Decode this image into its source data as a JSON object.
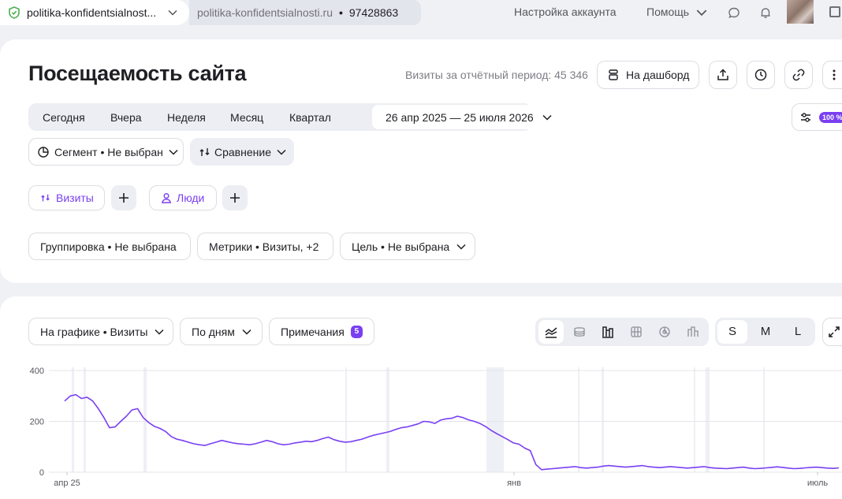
{
  "topbar": {
    "site_name": "politika-konfidentsialnost...",
    "counter_domain": "politika-konfidentsialnosti.ru",
    "counter_separator": "•",
    "counter_id": "97428863",
    "account_settings": "Настройка аккаунта",
    "help": "Помощь"
  },
  "header": {
    "title": "Посещаемость сайта",
    "visits_total": "Визиты за отчётный период: 45 346",
    "dashboard_button": "На дашборд"
  },
  "period": {
    "options": [
      "Сегодня",
      "Вчера",
      "Неделя",
      "Месяц",
      "Квартал"
    ],
    "selected_range": "26 апр 2025 — 25 июля 2026",
    "sampling_badge": "100 %"
  },
  "filters": {
    "segment": "Сегмент • Не выбран",
    "comparison": "Сравнение"
  },
  "reports": {
    "visits": "Визиты",
    "people": "Люди"
  },
  "settings": {
    "grouping": "Группировка • Не выбрана",
    "metrics": "Метрики • Визиты, +2",
    "goal": "Цель • Не выбрана"
  },
  "chart_controls": {
    "on_chart": "На графике • Визиты",
    "by_days": "По дням",
    "notes": "Примечания",
    "notes_count": "5",
    "chart_types": [
      "line-chart-icon",
      "area-stack-icon",
      "bar-chart-icon",
      "table-grid-icon",
      "pie-chart-icon",
      "column-chart-icon"
    ],
    "sizes": [
      "S",
      "M",
      "L"
    ],
    "selected_size": "S"
  },
  "colors": {
    "accent": "#7a3ff2",
    "series": "#7a3ff2",
    "gridline": "#e4e5ea"
  },
  "chart_data": {
    "type": "line",
    "title": "",
    "xlabel": "",
    "ylabel": "",
    "ylim": [
      0,
      400
    ],
    "y_ticks": [
      0,
      200,
      400
    ],
    "x_ticks": [
      "апр 25",
      "янв",
      "июль"
    ],
    "grid": "horizontal",
    "series": [
      {
        "values": [
          280,
          300,
          305,
          290,
          295,
          280,
          250,
          215,
          175,
          178,
          200,
          220,
          245,
          250,
          215,
          195,
          180,
          172,
          160,
          140,
          130,
          125,
          118,
          112,
          108,
          105,
          112,
          118,
          125,
          120,
          115,
          112,
          110,
          108,
          112,
          118,
          125,
          120,
          112,
          108,
          110,
          115,
          118,
          122,
          120,
          125,
          132,
          138,
          128,
          122,
          118,
          120,
          125,
          130,
          138,
          145,
          150,
          155,
          160,
          168,
          175,
          178,
          184,
          190,
          200,
          198,
          192,
          205,
          210,
          212,
          220,
          215,
          206,
          200,
          192,
          180,
          165,
          152,
          140,
          128,
          115,
          110,
          95,
          85,
          30,
          10,
          12,
          14,
          16,
          18,
          20,
          22,
          18,
          16,
          18,
          20,
          24,
          26,
          24,
          22,
          20,
          22,
          24,
          26,
          22,
          20,
          18,
          20,
          22,
          20,
          18,
          16,
          18,
          20,
          22,
          18,
          16,
          15,
          14,
          16,
          18,
          20,
          16,
          14,
          15,
          17,
          19,
          21,
          19,
          16,
          14,
          15,
          17,
          19,
          20,
          18,
          16,
          15,
          17
        ]
      }
    ]
  }
}
